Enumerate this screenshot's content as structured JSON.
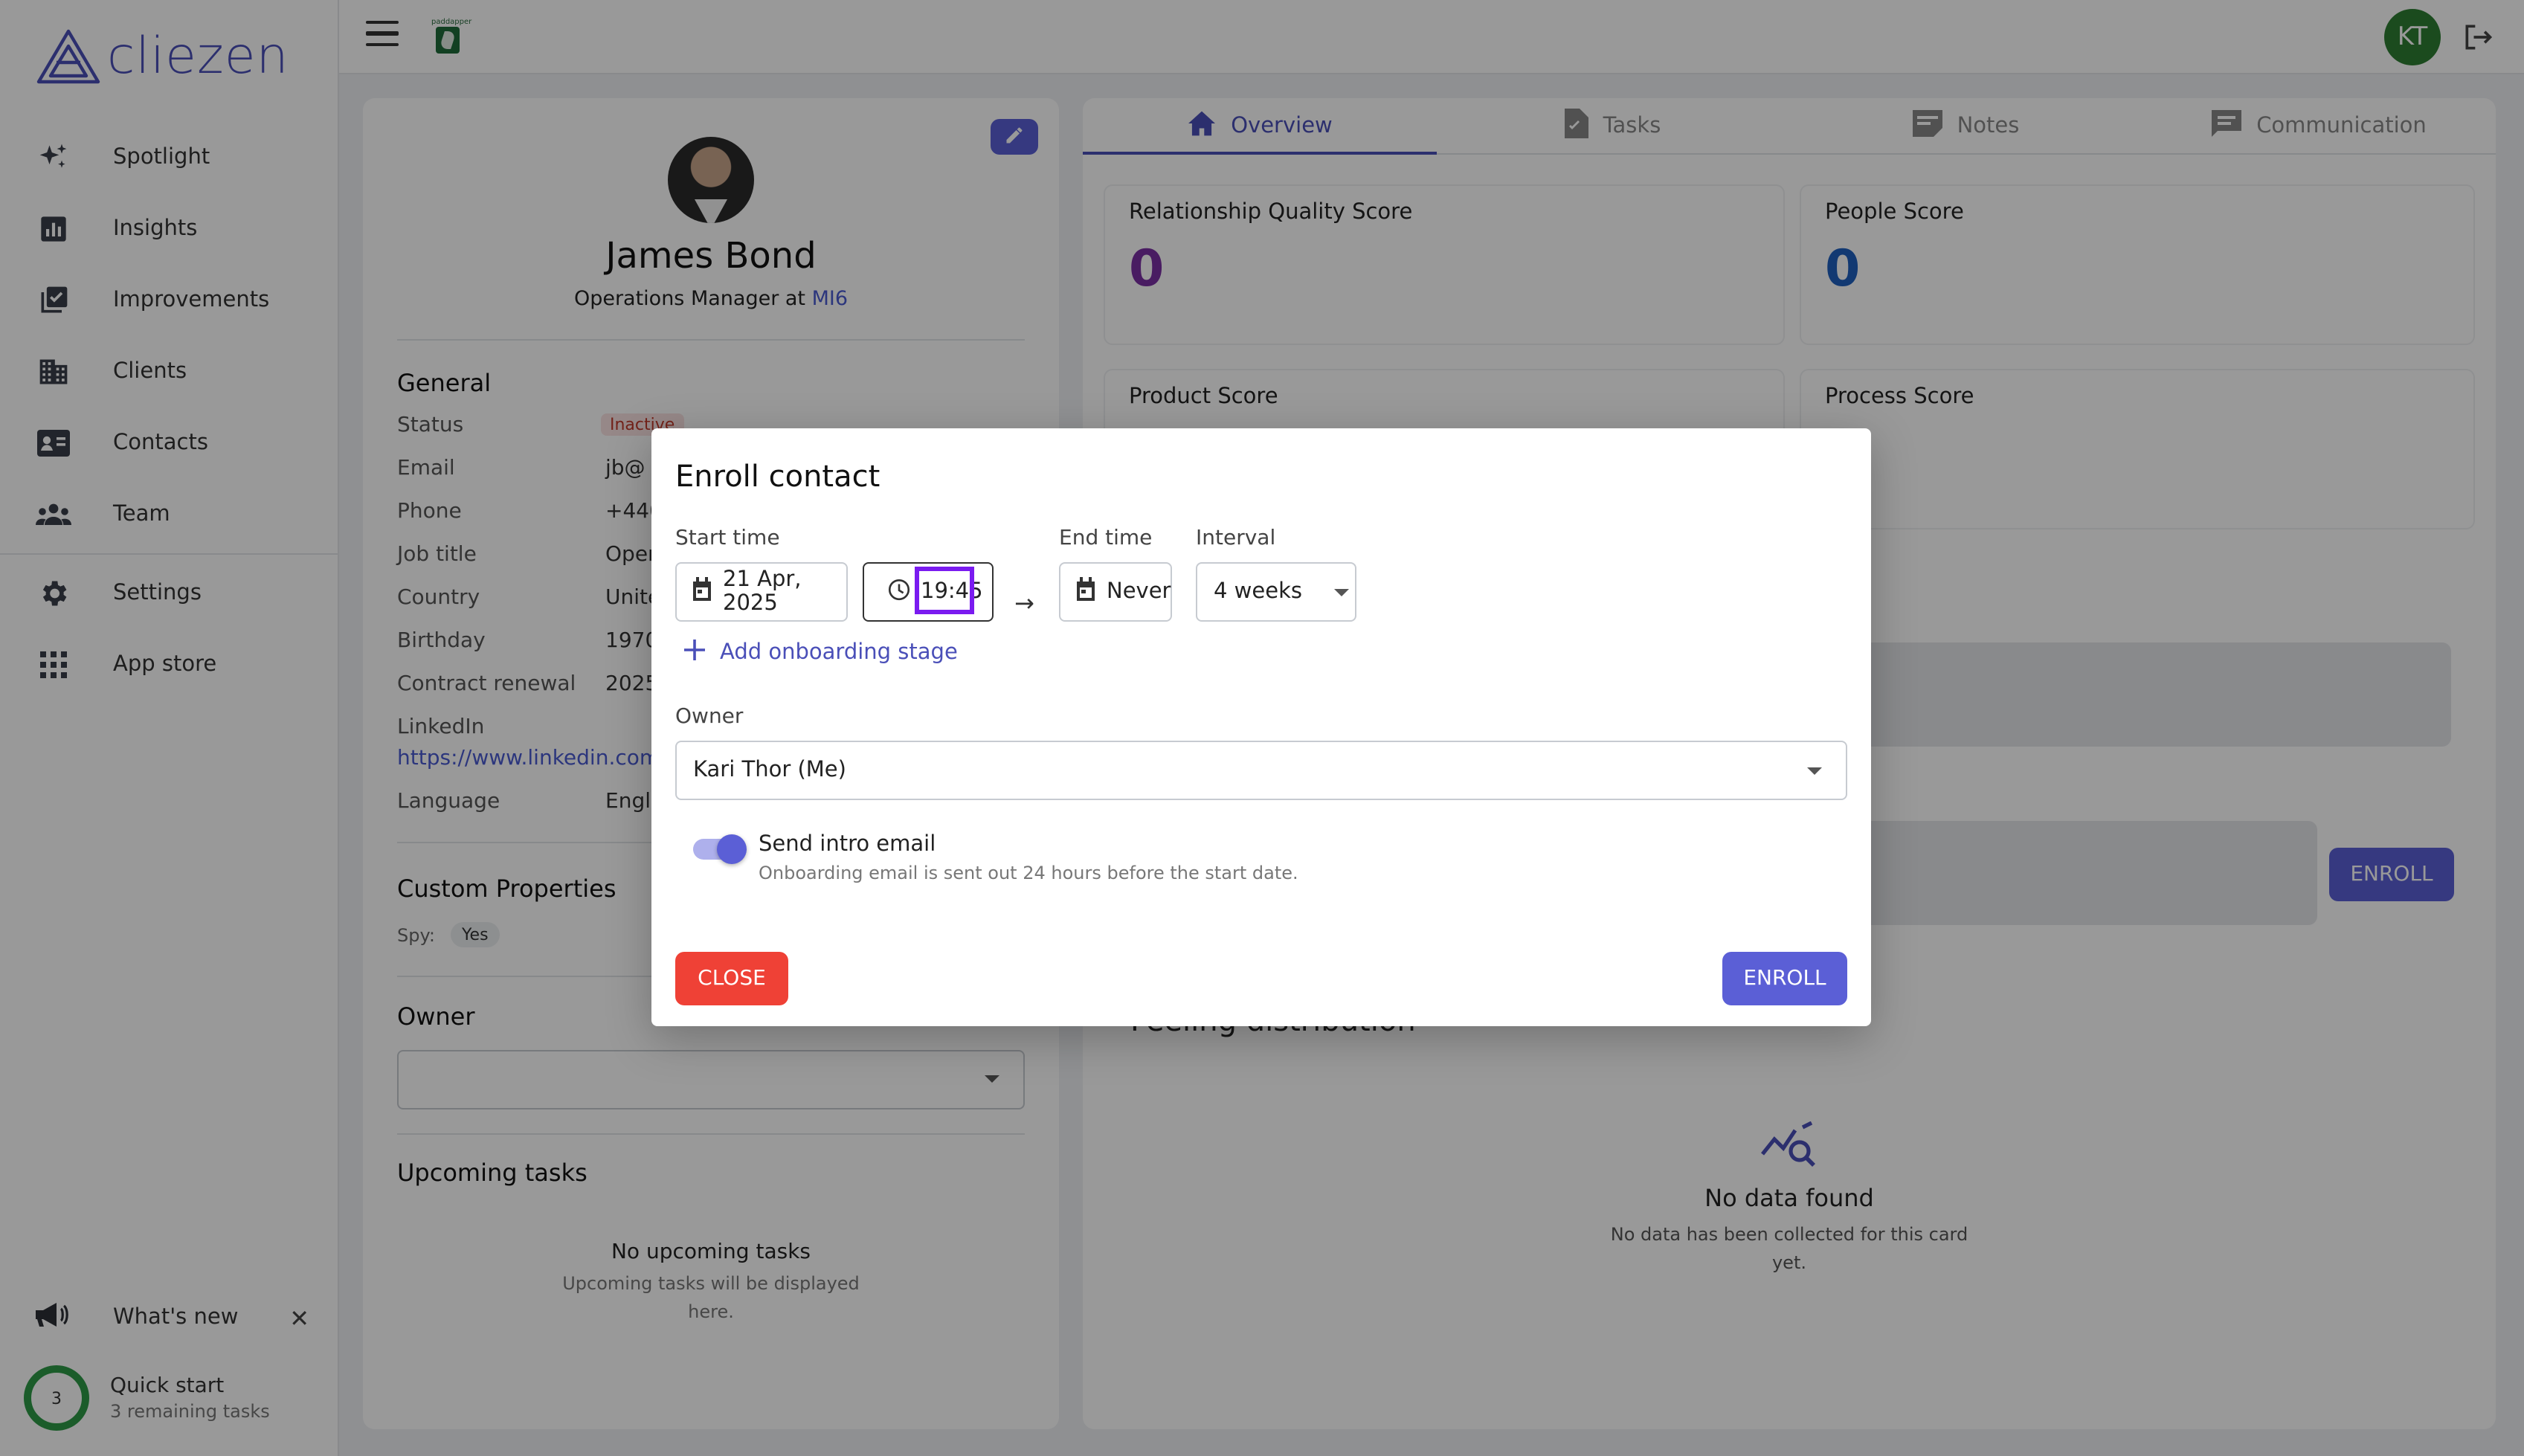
{
  "brand": {
    "name": "cliezen"
  },
  "sidebar": {
    "items": [
      {
        "label": "Spotlight",
        "icon": "sparkle-icon"
      },
      {
        "label": "Insights",
        "icon": "bar-chart-icon"
      },
      {
        "label": "Improvements",
        "icon": "checklist-icon"
      },
      {
        "label": "Clients",
        "icon": "building-icon"
      },
      {
        "label": "Contacts",
        "icon": "contact-card-icon"
      },
      {
        "label": "Team",
        "icon": "people-icon"
      },
      {
        "label": "Settings",
        "icon": "gear-icon"
      },
      {
        "label": "App store",
        "icon": "grid-icon"
      }
    ],
    "whats_new": "What's new",
    "quick_start": {
      "title": "Quick start",
      "subtitle": "3 remaining tasks",
      "count": "3"
    }
  },
  "topbar": {
    "avatar_initials": "KT",
    "company_logo_text": "paddapper"
  },
  "profile": {
    "name": "James Bond",
    "role_prefix": "Operations Manager at",
    "org": "MI6",
    "general_title": "General",
    "fields": {
      "status": {
        "label": "Status",
        "value": "Inactive"
      },
      "email": {
        "label": "Email",
        "value": "jb@"
      },
      "phone": {
        "label": "Phone",
        "value": "+440"
      },
      "job_title": {
        "label": "Job title",
        "value": "Oper"
      },
      "country": {
        "label": "Country",
        "value": "Unite"
      },
      "birthday": {
        "label": "Birthday",
        "value": "1970,"
      },
      "contract_renewal": {
        "label": "Contract renewal",
        "value": "2025"
      },
      "linkedin": {
        "label": "LinkedIn",
        "value": "https://www.linkedin.com/i"
      },
      "language": {
        "label": "Language",
        "value": "Engli"
      }
    },
    "custom_properties_title": "Custom Properties",
    "spy": {
      "label": "Spy:",
      "value": "Yes"
    },
    "owner_title": "Owner",
    "upcoming_title": "Upcoming tasks",
    "upcoming_empty_title": "No upcoming tasks",
    "upcoming_empty_sub": "Upcoming tasks will be displayed here."
  },
  "tabs": [
    {
      "label": "Overview",
      "active": true
    },
    {
      "label": "Tasks",
      "active": false
    },
    {
      "label": "Notes",
      "active": false
    },
    {
      "label": "Communication",
      "active": false
    }
  ],
  "scores": {
    "relationship": {
      "label": "Relationship Quality Score",
      "value": "0",
      "color": "#7b2fa3"
    },
    "people": {
      "label": "People Score",
      "value": "0",
      "color": "#1f5fbf"
    },
    "product": {
      "label": "Product Score"
    },
    "process": {
      "label": "Process Score"
    }
  },
  "background_enroll_label": "ENROLL",
  "feeling_title": "Feeling distribution",
  "no_data": {
    "title": "No data found",
    "subtitle": "No data has been collected for this card yet."
  },
  "modal": {
    "title": "Enroll contact",
    "start_time_label": "Start time",
    "start_date": "21 Apr, 2025",
    "start_time": "19:45",
    "end_time_label": "End time",
    "end_time": "Never",
    "interval_label": "Interval",
    "interval": "4 weeks",
    "add_stage": "Add onboarding stage",
    "owner_label": "Owner",
    "owner_value": "Kari Thor (Me)",
    "intro_title": "Send intro email",
    "intro_sub": "Onboarding email is sent out 24 hours before the start date.",
    "intro_enabled": true,
    "close_label": "CLOSE",
    "enroll_label": "ENROLL"
  },
  "colors": {
    "accent": "#5b5fd6",
    "danger": "#ef4136",
    "focus": "#7a1bf0"
  }
}
